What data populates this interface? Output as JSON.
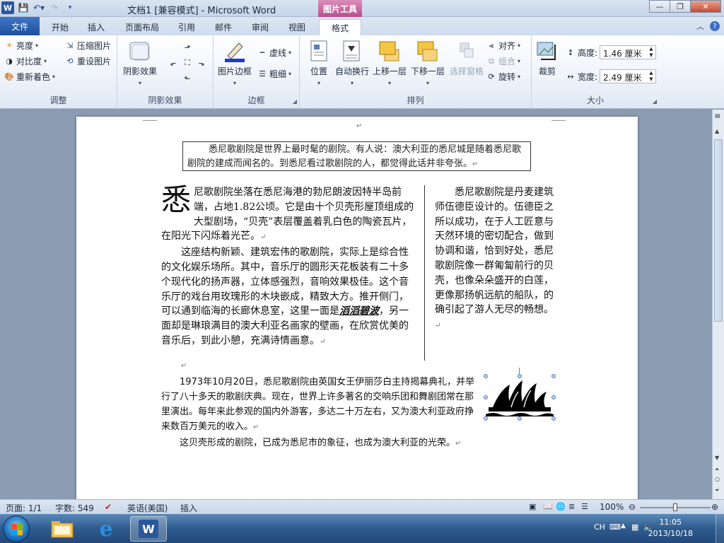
{
  "window": {
    "title": "文档1 [兼容模式] - Microsoft Word",
    "tool_tab": "图片工具",
    "minimize": "—",
    "restore": "❐",
    "close": "✕"
  },
  "tabs": {
    "file": "文件",
    "home": "开始",
    "insert": "插入",
    "layout": "页面布局",
    "references": "引用",
    "mailings": "邮件",
    "review": "审阅",
    "view": "视图",
    "format": "格式",
    "help": "?",
    "collapse": "︿"
  },
  "ribbon": {
    "adjust": {
      "label": "调整",
      "brightness": "亮度",
      "contrast": "对比度",
      "recolor": "重新着色",
      "compress": "压缩图片",
      "reset": "重设图片"
    },
    "shadow": {
      "label": "阴影效果",
      "shadow_effects": "阴影效果"
    },
    "border": {
      "label": "边框",
      "picture_border": "图片边框",
      "dashes": "虚线",
      "weight": "粗细"
    },
    "arrange": {
      "label": "排列",
      "position": "位置",
      "wrap": "自动换行",
      "bring_forward": "上移一层",
      "send_backward": "下移一层",
      "selection_pane": "选择窗格",
      "align": "对齐",
      "group": "组合",
      "rotate": "旋转"
    },
    "size": {
      "label": "大小",
      "crop": "裁剪",
      "height_label": "高度:",
      "height_value": "1.46 厘米",
      "width_label": "宽度:",
      "width_value": "2.49 厘米"
    }
  },
  "document": {
    "boxed_text": "悉尼歌剧院是世界上最时髦的剧院。有人说：澳大利亚的悉尼城是随着悉尼歌剧院的建成而闻名的。到悉尼看过歌剧院的人，都觉得此话并非夸张。",
    "col1_dropcap": "悉",
    "col1_p1": "尼歌剧院坐落在悉尼海港的勃尼朗波因特半岛前端，占地1.82公顷。它是由十个贝壳形屋顶组成的大型剧场，“贝壳”表层覆盖着乳白色的陶瓷瓦片，在阳光下闪烁着光芒。",
    "col1_p2_a": "这座结构新颖、建筑宏伟的歌剧院，实际上是综合性的文化娱乐场所。其中，音乐厅的圆形天花板装有二十多个现代化的扬声器，立体感强烈，音响效果极佳。这个音乐厅的戏台用玫瑰形的木块嵌成，精致大方。推开侧门，可以通到临海的长廊休息室，这里一面是",
    "col1_p2_em": "滔滔碧波",
    "col1_p2_b": "，另一面却是琳琅满目的澳大利亚名画家的壁画，在欣赏优美的音乐后，到此小憩，充满诗情画意。",
    "col2_text": "悉尼歌剧院是丹麦建筑师伍德臣设计的。伍德臣之所以成功，在于人工匠意与天然环境的密切配合，做到协调和谐，恰到好处，悉尼歌剧院像一群匍匐前行的贝壳，也像朵朵盛开的白莲，更像那扬帆远航的船队，的确引起了游人无尽的畅想。",
    "body2": "1973年10月20日，悉尼歌剧院由英国女王伊丽莎白主持揭幕典礼，并举行了八十多天的歌剧庆典。现在，世界上许多著名的交响乐团和舞剧团常在那里演出。每年来此参观的国内外游客，多达二十万左右，又为澳大利亚政府挣来数百万美元的收入。",
    "body3": "这贝壳形成的剧院，已成为悉尼市的象征，也成为澳大利亚的光荣。",
    "para_mark": "↵"
  },
  "status": {
    "page": "页面: 1/1",
    "words": "字数: 549",
    "language": "英语(美国)",
    "mode": "插入",
    "zoom": "100%",
    "zoom_level": 0.5
  },
  "taskbar": {
    "ime": "CH",
    "time": "11:05",
    "date": "2013/10/18"
  }
}
